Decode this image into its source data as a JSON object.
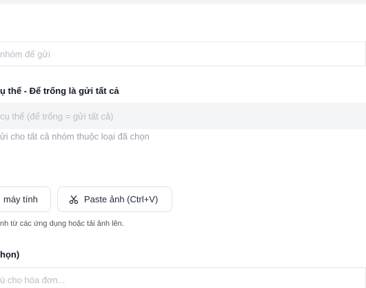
{
  "group_select": {
    "placeholder": "nhóm để gửi"
  },
  "specific_group": {
    "label": "ụ thể - Để trống là gửi tất cả",
    "placeholder": "cụ thể (để trống = gửi tất cả)",
    "hint": "ửi cho tất cả nhóm thuộc loại đã chọn"
  },
  "image_upload": {
    "from_computer_label": "máy tính",
    "paste_label": "Paste ảnh (Ctrl+V)",
    "paste_icon": "scissors-icon",
    "hint": "nh từ các ứng dụng hoặc tải ảnh lên."
  },
  "note": {
    "label": "họn)",
    "placeholder": "ú cho hóa đơn..."
  }
}
